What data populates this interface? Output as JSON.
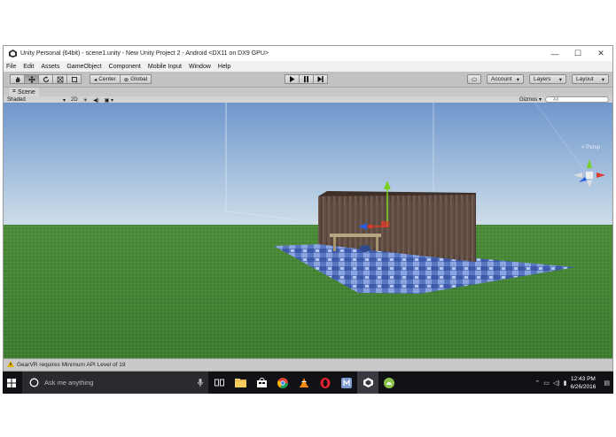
{
  "window": {
    "title": "Unity Personal (64bit) - scene1.unity - New Unity Project 2 - Android <DX11 on DX9 GPU>",
    "controls": {
      "minimize": "—",
      "maximize": "☐",
      "close": "✕"
    }
  },
  "menu": [
    "File",
    "Edit",
    "Assets",
    "GameObject",
    "Component",
    "Mobile Input",
    "Window",
    "Help"
  ],
  "toolbar": {
    "tools": [
      "hand-tool-icon",
      "move-tool-icon",
      "rotate-tool-icon",
      "scale-tool-icon",
      "rect-tool-icon"
    ],
    "pivot_label": "Center",
    "space_label": "Global",
    "account_label": "Account",
    "layers_label": "Layers",
    "layout_label": "Layout"
  },
  "scene": {
    "tab_label": "Scene",
    "shading_label": "Shaded",
    "mode_2d": "2D",
    "gizmos_label": "Gizmos",
    "search_placeholder": "All",
    "projection_label": "< Persp"
  },
  "status": {
    "message": "GearVR requires Minimum API Level of 19"
  },
  "taskbar": {
    "search_placeholder": "Ask me anything",
    "time": "12:43 PM",
    "date": "6/26/2016"
  },
  "colors": {
    "sky_top": "#6f96cc",
    "ground": "#3f7e34",
    "taskbar": "#101114",
    "toolbar": "#c2c2c2"
  }
}
